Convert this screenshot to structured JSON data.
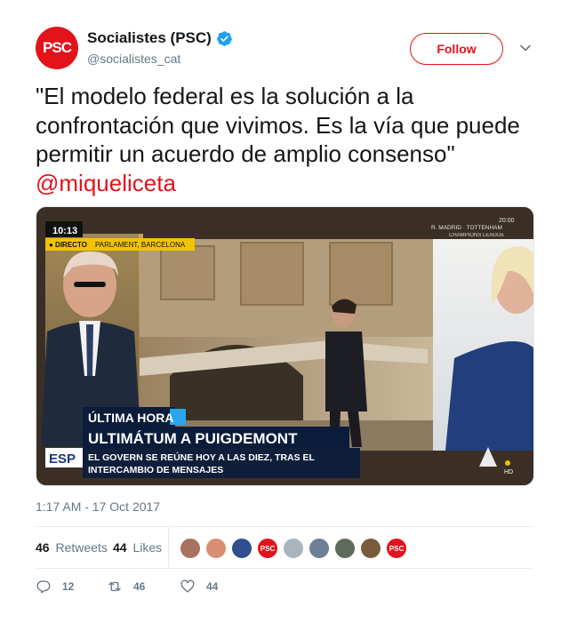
{
  "account": {
    "display_name": "Socialistes (PSC)",
    "handle": "@socialistes_cat",
    "avatar_text": "PSC",
    "verified": true
  },
  "follow_label": "Follow",
  "tweet": {
    "text": "\"El modelo federal es la solución a la confrontación que vivimos. Es la vía que puede permitir un acuerdo de amplio consenso\" ",
    "mention": "@miqueliceta"
  },
  "media": {
    "time": "10:13",
    "live_label": "● DIRECTO",
    "location": "PARLAMENT, BARCELONA",
    "clock": "20:00",
    "match": "R. MADRID · TOTTENHAM",
    "competition": "CHAMPIONS LEAGUE",
    "breaking_label": "ÚLTIMA HORA",
    "headline": "ULTIMÁTUM A PUIGDEMONT",
    "subline_1": "EL GOVERN SE REÚNE HOY A LAS DIEZ, TRAS EL",
    "subline_2": "INTERCAMBIO DE MENSAJES",
    "channel_tag": "ESP",
    "channel_badge": "HD"
  },
  "timestamp": "1:17 AM - 17 Oct 2017",
  "stats": {
    "retweets_count": "46",
    "retweets_label": "Retweets",
    "likes_count": "44",
    "likes_label": "Likes"
  },
  "actions": {
    "replies": "12",
    "retweets": "46",
    "likes": "44"
  },
  "colors": {
    "accent": "#e3131b",
    "verified": "#1da1f2",
    "muted": "#657786"
  }
}
